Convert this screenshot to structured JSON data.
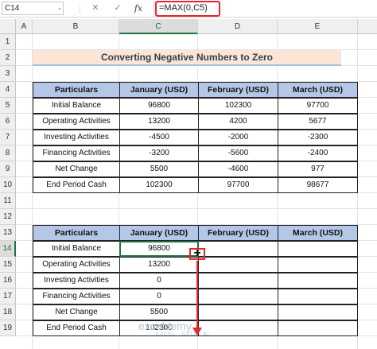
{
  "formula_bar": {
    "name_box": "C14",
    "name_box_arrow": "⌄",
    "separator": "⋮",
    "cancel_glyph": "✕",
    "enter_glyph": "✓",
    "fx_glyph": "fx",
    "formula": "=MAX(0,C5)",
    "highlight_color": "#e8262d"
  },
  "columns": [
    "A",
    "B",
    "C",
    "D",
    "E"
  ],
  "selected_column": "C",
  "rows": [
    "1",
    "2",
    "3",
    "4",
    "5",
    "6",
    "7",
    "8",
    "9",
    "10",
    "11",
    "12",
    "13",
    "14",
    "15",
    "16",
    "17",
    "18",
    "19"
  ],
  "selected_row": "14",
  "title": "Converting Negative Numbers to Zero",
  "table1": {
    "headers": [
      "Particulars",
      "January (USD)",
      "February (USD)",
      "March (USD)"
    ],
    "rows": [
      [
        "Initial Balance",
        "96800",
        "102300",
        "97700"
      ],
      [
        "Operating Activities",
        "13200",
        "4200",
        "5677"
      ],
      [
        "Investing Activities",
        "-4500",
        "-2000",
        "-2300"
      ],
      [
        "Financing Activities",
        "-3200",
        "-5600",
        "-2400"
      ],
      [
        "Net Change",
        "5500",
        "-4600",
        "977"
      ],
      [
        "End Period Cash",
        "102300",
        "97700",
        "98677"
      ]
    ]
  },
  "table2": {
    "headers": [
      "Particulars",
      "January (USD)",
      "February (USD)",
      "March (USD)"
    ],
    "rows": [
      [
        "Initial Balance",
        "96800",
        "",
        ""
      ],
      [
        "Operating Activities",
        "13200",
        "",
        ""
      ],
      [
        "Investing Activities",
        "0",
        "",
        ""
      ],
      [
        "Financing Activities",
        "0",
        "",
        ""
      ],
      [
        "Net Change",
        "5500",
        "",
        ""
      ],
      [
        "End Period Cash",
        "102300",
        "",
        ""
      ]
    ]
  },
  "fill_handle_glyph": "+",
  "watermark": {
    "text": "exceldemy",
    "subtext": "EXCEL · DATA · BI"
  },
  "colors": {
    "header_fill": "#b4c7e7",
    "title_fill": "#fbe5d6",
    "title_underline": "#9dc3e6",
    "selection": "#217346",
    "annotation": "#e8262d"
  }
}
